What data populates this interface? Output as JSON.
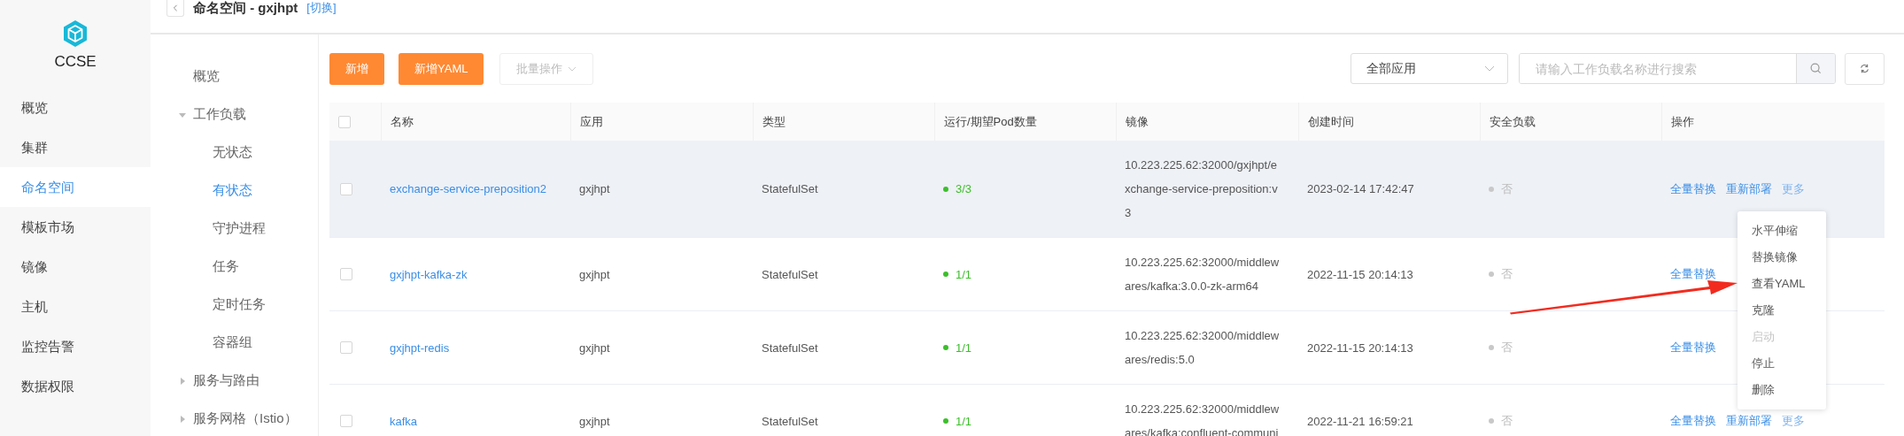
{
  "logo": {
    "text": "CCSE"
  },
  "sidebar": {
    "items": [
      {
        "label": "概览",
        "selected": false
      },
      {
        "label": "集群",
        "selected": false
      },
      {
        "label": "命名空间",
        "selected": true
      },
      {
        "label": "模板市场",
        "selected": false
      },
      {
        "label": "镜像",
        "selected": false
      },
      {
        "label": "主机",
        "selected": false
      },
      {
        "label": "监控告警",
        "selected": false
      },
      {
        "label": "数据权限",
        "selected": false
      }
    ]
  },
  "header": {
    "title": "命名空间 - gxjhpt",
    "switch_link": "[切换]"
  },
  "subnav": {
    "items": [
      {
        "label": "概览",
        "selected": false
      },
      {
        "label": "工作负载",
        "selected": false,
        "expanded": true,
        "children": [
          {
            "label": "无状态",
            "selected": false
          },
          {
            "label": "有状态",
            "selected": true
          },
          {
            "label": "守护进程",
            "selected": false
          },
          {
            "label": "任务",
            "selected": false
          },
          {
            "label": "定时任务",
            "selected": false
          },
          {
            "label": "容器组",
            "selected": false
          }
        ]
      },
      {
        "label": "服务与路由",
        "selected": false,
        "expanded": false
      },
      {
        "label": "服务网格（Istio）",
        "selected": false,
        "expanded": false
      }
    ]
  },
  "toolbar": {
    "buttons": [
      {
        "label": "新增",
        "disabled": false
      },
      {
        "label": "新增YAML",
        "disabled": false
      },
      {
        "label": "批量操作",
        "disabled": true
      }
    ],
    "app_select": "全部应用",
    "search": {
      "placeholder": "请输入工作负载名称进行搜索"
    }
  },
  "table": {
    "header_checked": false,
    "columns": [
      "名称",
      "应用",
      "类型",
      "运行/期望Pod数量",
      "镜像",
      "创建时间",
      "安全负载",
      "操作"
    ],
    "rows": [
      {
        "checked": false,
        "highlighted": true,
        "name": "exchange-service-preposition2",
        "app": "gxjhpt",
        "type": "StatefulSet",
        "pods": "3/3",
        "image": "10.223.225.62:32000/gxjhpt/exchange-service-preposition:v3",
        "created": "2023-02-14 17:42:47",
        "secure": "否",
        "actions": [
          "全量替换",
          "重新部署",
          "更多"
        ]
      },
      {
        "checked": false,
        "highlighted": false,
        "name": "gxjhpt-kafka-zk",
        "app": "gxjhpt",
        "type": "StatefulSet",
        "pods": "1/1",
        "image": "10.223.225.62:32000/middlewares/kafka:3.0.0-zk-arm64",
        "created": "2022-11-15 20:14:13",
        "secure": "否",
        "actions": [
          "全量替换"
        ]
      },
      {
        "checked": false,
        "highlighted": false,
        "name": "gxjhpt-redis",
        "app": "gxjhpt",
        "type": "StatefulSet",
        "pods": "1/1",
        "image": "10.223.225.62:32000/middlewares/redis:5.0",
        "created": "2022-11-15 20:14:13",
        "secure": "否",
        "actions": [
          "全量替换"
        ]
      },
      {
        "checked": false,
        "highlighted": false,
        "name": "kafka",
        "app": "gxjhpt",
        "type": "StatefulSet",
        "pods": "1/1",
        "image": "10.223.225.62:32000/middlewares/kafka:confluent-communi",
        "created": "2022-11-21 16:59:21",
        "secure": "否",
        "actions": [
          "全量替换",
          "重新部署",
          "更多"
        ]
      }
    ]
  },
  "more_menu": {
    "items": [
      {
        "label": "水平伸缩",
        "disabled": false
      },
      {
        "label": "替换镜像",
        "disabled": false
      },
      {
        "label": "查看YAML",
        "disabled": false
      },
      {
        "label": "克隆",
        "disabled": false
      },
      {
        "label": "启动",
        "disabled": true
      },
      {
        "label": "停止",
        "disabled": false
      },
      {
        "label": "删除",
        "disabled": false
      }
    ]
  }
}
